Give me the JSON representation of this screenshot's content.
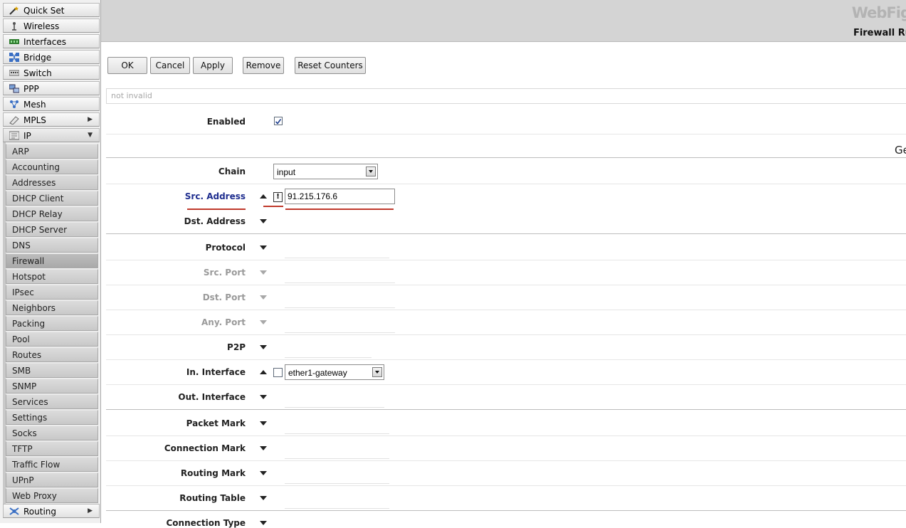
{
  "sidebar": {
    "top_items": [
      {
        "label": "Quick Set",
        "icon": "wand-icon"
      },
      {
        "label": "Wireless",
        "icon": "antenna-icon"
      },
      {
        "label": "Interfaces",
        "icon": "network-card-icon"
      },
      {
        "label": "Bridge",
        "icon": "bridge-icon"
      },
      {
        "label": "Switch",
        "icon": "switch-icon"
      },
      {
        "label": "PPP",
        "icon": "ppp-icon"
      },
      {
        "label": "Mesh",
        "icon": "mesh-icon"
      },
      {
        "label": "MPLS",
        "icon": "mpls-icon",
        "arrow": "▶"
      },
      {
        "label": "IP",
        "icon": "ip-icon",
        "arrow": "▼"
      }
    ],
    "ip_submenu": [
      "ARP",
      "Accounting",
      "Addresses",
      "DHCP Client",
      "DHCP Relay",
      "DHCP Server",
      "DNS",
      "Firewall",
      "Hotspot",
      "IPsec",
      "Neighbors",
      "Packing",
      "Pool",
      "Routes",
      "SMB",
      "SNMP",
      "Services",
      "Settings",
      "Socks",
      "TFTP",
      "Traffic Flow",
      "UPnP",
      "Web Proxy"
    ],
    "active_sub": "Firewall",
    "bottom_item": {
      "label": "Routing",
      "icon": "routing-icon",
      "arrow": "▶"
    }
  },
  "header": {
    "brand": "WebFig",
    "title": "Firewall Ru"
  },
  "toolbar": {
    "ok": "OK",
    "cancel": "Cancel",
    "apply": "Apply",
    "remove": "Remove",
    "reset_counters": "Reset Counters"
  },
  "status": "not invalid",
  "section_tab": "Ge",
  "form": {
    "enabled": {
      "label": "Enabled",
      "checked": true
    },
    "chain": {
      "label": "Chain",
      "value": "input"
    },
    "src_address": {
      "label": "Src. Address",
      "negate": "!",
      "value": "91.215.176.6"
    },
    "dst_address": {
      "label": "Dst. Address"
    },
    "protocol": {
      "label": "Protocol"
    },
    "src_port": {
      "label": "Src. Port"
    },
    "dst_port": {
      "label": "Dst. Port"
    },
    "any_port": {
      "label": "Any. Port"
    },
    "p2p": {
      "label": "P2P"
    },
    "in_interface": {
      "label": "In. Interface",
      "value": "ether1-gateway"
    },
    "out_interface": {
      "label": "Out. Interface"
    },
    "packet_mark": {
      "label": "Packet Mark"
    },
    "connection_mark": {
      "label": "Connection Mark"
    },
    "routing_mark": {
      "label": "Routing Mark"
    },
    "routing_table": {
      "label": "Routing Table"
    },
    "connection_type": {
      "label": "Connection Type"
    }
  },
  "colors": {
    "accent_label": "#1f2e8f",
    "error_underline": "#c0392b"
  }
}
